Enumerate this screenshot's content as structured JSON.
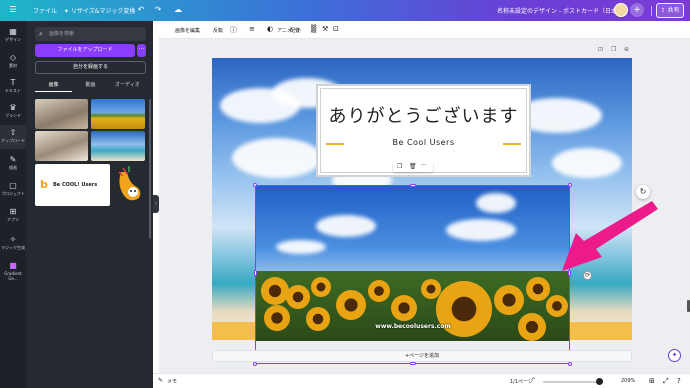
{
  "topbar": {
    "file_label": "ファイル",
    "resize_label": "✦ リサイズ&マジック変換",
    "undo_icon": "undo-icon",
    "redo_icon": "redo-icon",
    "cloud_icon": "cloud-icon",
    "doc_title": "名称未設定のデザイン - ポストカード（日本）",
    "share_label": "共有",
    "brand_gradient": [
      "#1fb6c9",
      "#3d6fd8",
      "#7b3bd3"
    ]
  },
  "rail": {
    "items": [
      {
        "label": "デザイン",
        "icon": "layout-icon"
      },
      {
        "label": "素材",
        "icon": "shapes-icon"
      },
      {
        "label": "テキスト",
        "icon": "text-icon"
      },
      {
        "label": "ブランド",
        "icon": "brand-icon"
      },
      {
        "label": "アップロード",
        "icon": "cloud-upload-icon"
      },
      {
        "label": "描画",
        "icon": "pen-icon"
      },
      {
        "label": "プロジェクト",
        "icon": "folder-icon"
      },
      {
        "label": "アプリ",
        "icon": "apps-icon"
      },
      {
        "label": "マジック生成",
        "icon": "magic-icon"
      },
      {
        "label": "Gradient Ge...",
        "icon": "gradient-app-icon"
      }
    ]
  },
  "panel": {
    "search_placeholder": "画像を検索",
    "upload_label": "ファイルをアップロード",
    "more_label": "···",
    "record_label": "自分を録画する",
    "tabs": [
      "画像",
      "動画",
      "オーディオ"
    ],
    "logo_text": "Be COOL! Users"
  },
  "toolbar": {
    "edit_image": "画像を編集",
    "flip": "反転",
    "animate": "アニメート",
    "position": "配置"
  },
  "canvas": {
    "headline": "ありがとうございます",
    "subline": "Be Cool Users",
    "watermark": "www.becoolusers.com",
    "add_page": "+ページを追加"
  },
  "bottombar": {
    "notes_label": "メモ",
    "page_info": "1/1ページ",
    "zoom": "209%"
  }
}
